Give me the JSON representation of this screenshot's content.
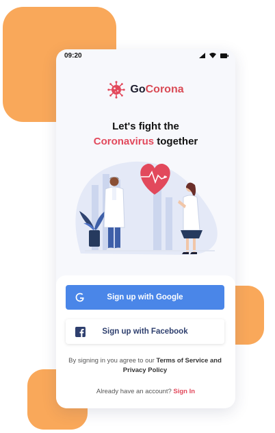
{
  "status_bar": {
    "time": "09:20"
  },
  "brand": {
    "name_prefix": "Go",
    "name_suffix": "Corona",
    "logo_icon": "virus-icon"
  },
  "headline": {
    "line1": "Let's fight the",
    "accent": "Coronavirus",
    "rest": " together"
  },
  "illustration": {
    "description_icon": "doctors-heart-illustration"
  },
  "buttons": {
    "google": {
      "label": "Sign up with Google",
      "icon": "google-icon"
    },
    "facebook": {
      "label": "Sign up with Facebook",
      "icon": "facebook-icon"
    }
  },
  "terms": {
    "prefix": "By signing in you agree to our ",
    "link1": "Terms of Service",
    "and": " and ",
    "link2": "Privacy Policy"
  },
  "signin": {
    "prompt": "Already have an account? ",
    "link": "Sign In"
  },
  "colors": {
    "accent": "#e2495c",
    "google_blue": "#4a86e8",
    "blob_orange": "#f9a85a"
  }
}
